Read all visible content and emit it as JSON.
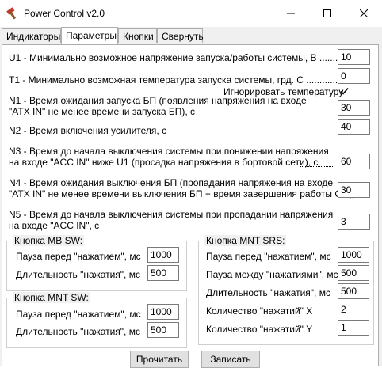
{
  "window": {
    "title": "Power Control v2.0",
    "app_icon": "hammer-icon"
  },
  "tabs": [
    "Индикаторы",
    "Параметры",
    "Кнопки",
    "Свернуть"
  ],
  "params": {
    "u1": {
      "label": "U1 - Минимально возможное напряжение запуска/работы системы, В ..............",
      "value": "10"
    },
    "t1": {
      "label": "T1 - Минимально возможная температура запуска системы, грд. С ....................",
      "value": "0"
    },
    "ignore_temp": {
      "label": "Игнорировать температуру",
      "checked": true
    },
    "n1": {
      "line1": "N1 - Время ожидания запуска БП (появления напряжения на входе",
      "line2": "\"ATX IN\" не менее времени запуска БП), с",
      "value": "30"
    },
    "n2": {
      "label": "N2 - Время включения усилителя, с",
      "value": "40"
    },
    "n3": {
      "line1": "N3 - Время до начала выключения системы при понижении напряжения",
      "line2": "на входе \"ACC IN\" ниже U1 (просадка напряжения в бортовой сети), с",
      "value": "60"
    },
    "n4": {
      "line1": "N4 - Время ожидания выключения БП (пропадания напряжения на входе",
      "line2": "\"ATX IN\" не менее времени выключения БП + время завершения работы ОС), с",
      "value": "30"
    },
    "n5": {
      "line1": "N5 - Время до начала выключения системы при пропадании напряжения",
      "line2": "на входе \"ACC IN\", с",
      "value": "3"
    }
  },
  "groups": {
    "mb_sw": {
      "title": "Кнопка MB SW:",
      "pause_label": "Пауза перед \"нажатием\", мс",
      "pause_value": "1000",
      "duration_label": "Длительность \"нажатия\", мс",
      "duration_value": "500"
    },
    "mnt_sw": {
      "title": "Кнопка MNT SW:",
      "pause_label": "Пауза перед \"нажатием\", мс",
      "pause_value": "1000",
      "duration_label": "Длительность \"нажатия\", мс",
      "duration_value": "500"
    },
    "mnt_srs": {
      "title": "Кнопка MNT SRS:",
      "pause_label": "Пауза перед \"нажатием\", мс",
      "pause_value": "1000",
      "between_label": "Пауза между \"нажатиями\", мс",
      "between_value": "500",
      "duration_label": "Длительность \"нажатия\", мс",
      "duration_value": "500",
      "count_x_label": "Количество \"нажатий\" X",
      "count_x_value": "2",
      "count_y_label": "Количество \"нажатий\" Y",
      "count_y_value": "1"
    }
  },
  "buttons": {
    "read": "Прочитать",
    "write": "Записать"
  }
}
